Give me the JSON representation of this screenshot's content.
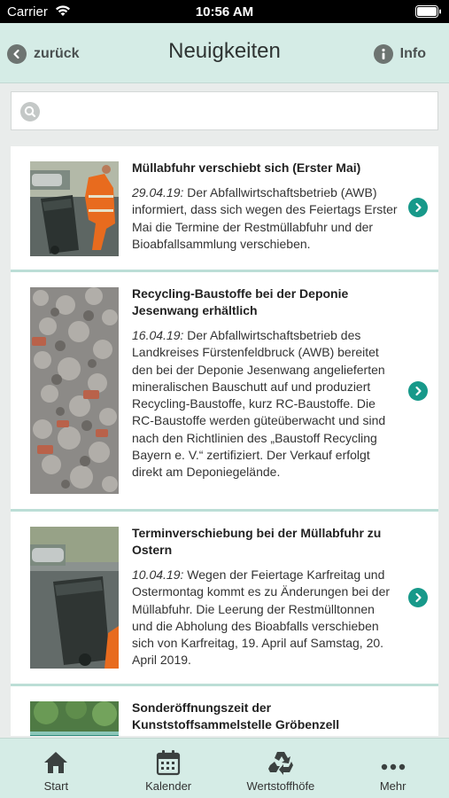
{
  "status_bar": {
    "carrier": "Carrier",
    "time": "10:56 AM"
  },
  "nav": {
    "back_label": "zurück",
    "title": "Neuigkeiten",
    "info_label": "Info"
  },
  "search": {
    "placeholder": "",
    "value": ""
  },
  "news": [
    {
      "title": "Müllabfuhr verschiebt sich (Erster Mai)",
      "date": "29.04.19:",
      "body": " Der Abfallwirtschaftsbetrieb (AWB) informiert, dass sich wegen des Feiertags Erster Mai die Termine der Restmüllabfuhr und der Bioabfallsammlung verschieben."
    },
    {
      "title": "Recycling-Baustoffe bei der Deponie Jesenwang erhältlich",
      "date": "16.04.19:",
      "body": " Der Abfallwirtschaftsbetrieb des Landkreises Fürstenfeldbruck (AWB) bereitet den bei der Deponie Jesenwang angelieferten mineralischen Bauschutt auf und produziert Recycling-Baustoffe, kurz RC-Baustoffe. Die RC-Baustoffe werden güteüberwacht und sind nach den Richtlinien des „Baustoff Recycling Bayern e. V.“ zertifiziert. Der Verkauf erfolgt direkt am Deponiegelände."
    },
    {
      "title": "Terminverschiebung bei der Müllabfuhr zu Ostern",
      "date": "10.04.19:",
      "body": " Wegen der Feiertage Karfreitag und Ostermontag kommt es zu Änderungen bei der Müllabfuhr. Die Leerung der Restmülltonnen und die Abholung des Bioabfalls verschieben sich von Karfreitag, 19. April auf Samstag, 20. April 2019."
    },
    {
      "title": "Sonderöffnungszeit der Kunststoffsammelstelle Gröbenzell",
      "date": "",
      "body": ""
    }
  ],
  "tabs": [
    {
      "label": "Start",
      "icon": "home-icon"
    },
    {
      "label": "Kalender",
      "icon": "calendar-icon"
    },
    {
      "label": "Wertstoffhöfe",
      "icon": "recycle-icon"
    },
    {
      "label": "Mehr",
      "icon": "more-icon"
    }
  ],
  "colors": {
    "header_bg": "#d5ece6",
    "accent": "#17998a",
    "divider": "#bcded6"
  }
}
